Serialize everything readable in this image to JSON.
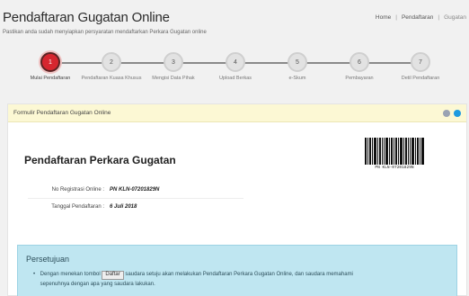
{
  "header": {
    "title": "Pendaftaran Gugatan Online",
    "subtitle": "Pastikan anda sudah menyiapkan persyaratan mendaftarkan Perkara Gugatan online"
  },
  "breadcrumb": [
    "Home",
    "Pendaftaran",
    "Gugatan"
  ],
  "steps": [
    {
      "number": "1",
      "label": "Mulai Pendaftaran",
      "active": true
    },
    {
      "number": "2",
      "label": "Pendaftaran Kuasa Khusus",
      "active": false
    },
    {
      "number": "3",
      "label": "Mengisi Data Pihak",
      "active": false
    },
    {
      "number": "4",
      "label": "Upload Berkas",
      "active": false
    },
    {
      "number": "5",
      "label": "e-Skum",
      "active": false
    },
    {
      "number": "6",
      "label": "Pembayaran",
      "active": false
    },
    {
      "number": "7",
      "label": "Detil Pendaftaran",
      "active": false
    }
  ],
  "panel": {
    "header_title": "Formulir Pendaftaran Gugatan Online",
    "form_title": "Pendaftaran Perkara Gugatan",
    "barcode_text": "PN KLN-07201829N",
    "fields": [
      {
        "label": "No Registrasi Online :",
        "value": "PN KLN-07201829N"
      },
      {
        "label": "Tanggal Pendaftaran :",
        "value": "6 Juli 2018"
      }
    ]
  },
  "agreement": {
    "title": "Persetujuan",
    "text_before": "Dengan menekan tombol",
    "button_label": "Daftar",
    "text_after": "saudara setuju akan melakukan Pendaftaran Perkara Gugatan Online, dan saudara memahami",
    "text_line2": "sepenuhnya dengan apa yang saudara lakukan."
  },
  "colors": {
    "active_step": "#d6262f",
    "panel_header_bg": "#fcf8d4",
    "agreement_bg": "#bfe6f1"
  }
}
